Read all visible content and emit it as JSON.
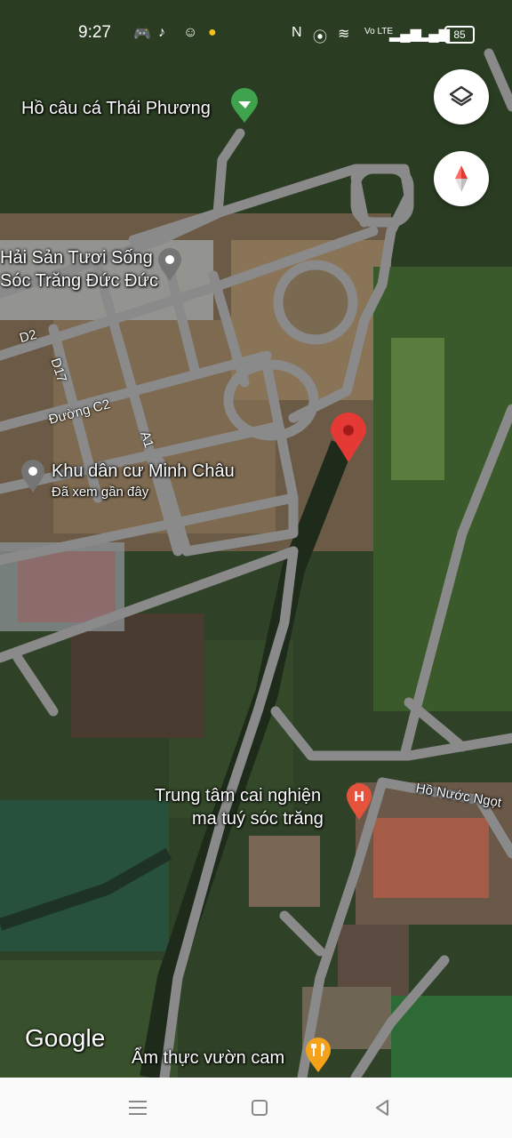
{
  "status_bar": {
    "time": "9:27",
    "battery": "85",
    "network": "Vo LTE"
  },
  "map": {
    "places": {
      "fishing": "Hồ câu cá Thái Phương",
      "seafood_line1": "Hải Sản Tươi Sống",
      "seafood_line2": "Sóc Trăng Đức Đức",
      "residential": "Khu dân cư Minh Châu",
      "residential_sub": "Đã xem gần đây",
      "rehab_line1": "Trung tâm cai nghiện",
      "rehab_line2": "ma tuý sóc trăng",
      "lake": "Hồ Nước Ngọt",
      "restaurant": "Ẩm thực vườn cam"
    },
    "roads": {
      "d2": "D2",
      "d17": "D17",
      "c2": "Đường C2",
      "a1": "A1"
    },
    "attribution": "Google"
  },
  "colors": {
    "pin": "#e53935",
    "road": "#8a8a8a",
    "place_icon": "#757575",
    "fishing_icon": "#3fa34d",
    "restaurant_icon": "#f4a21a"
  },
  "icons": {
    "layers": "layers-icon",
    "compass": "compass-icon"
  }
}
